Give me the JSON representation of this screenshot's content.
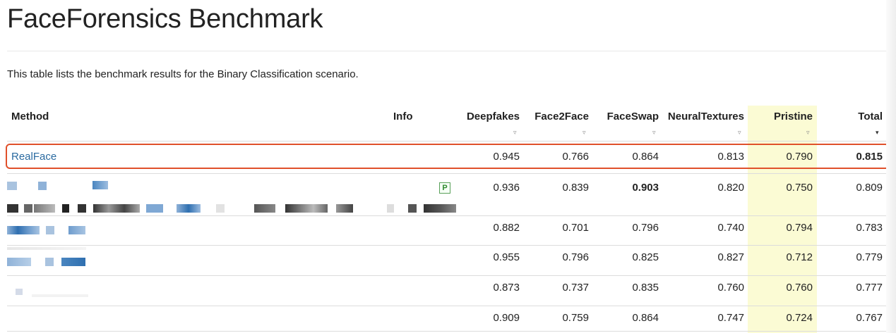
{
  "page": {
    "title": "FaceForensics Benchmark",
    "description": "This table lists the benchmark results for the Binary Classification scenario."
  },
  "table": {
    "columns": {
      "method": "Method",
      "info": "Info",
      "deepfakes": "Deepfakes",
      "face2face": "Face2Face",
      "faceswap": "FaceSwap",
      "neuraltextures": "NeuralTextures",
      "pristine": "Pristine",
      "total": "Total"
    },
    "sort_icons": {
      "inactive": "▿",
      "active": "▾"
    },
    "rows": [
      {
        "method": "RealFace",
        "deepfakes": "0.945",
        "face2face": "0.766",
        "faceswap": "0.864",
        "neuraltextures": "0.813",
        "pristine": "0.790",
        "total": "0.815"
      },
      {
        "method": "",
        "info_badge": "P",
        "deepfakes": "0.936",
        "face2face": "0.839",
        "faceswap": "0.903",
        "neuraltextures": "0.820",
        "pristine": "0.750",
        "total": "0.809"
      },
      {
        "method": "",
        "deepfakes": "0.882",
        "face2face": "0.701",
        "faceswap": "0.796",
        "neuraltextures": "0.740",
        "pristine": "0.794",
        "total": "0.783"
      },
      {
        "method": "",
        "deepfakes": "0.955",
        "face2face": "0.796",
        "faceswap": "0.825",
        "neuraltextures": "0.827",
        "pristine": "0.712",
        "total": "0.779"
      },
      {
        "method": "",
        "deepfakes": "0.873",
        "face2face": "0.737",
        "faceswap": "0.835",
        "neuraltextures": "0.760",
        "pristine": "0.760",
        "total": "0.777"
      },
      {
        "method": "",
        "deepfakes": "0.909",
        "face2face": "0.759",
        "faceswap": "0.864",
        "neuraltextures": "0.747",
        "pristine": "0.724",
        "total": "0.767"
      }
    ]
  },
  "colors": {
    "link": "#2a6aa0",
    "highlight_border": "#e0502a",
    "pristine_column": "#fbfbd4",
    "info_badge": "#2e8a2e"
  }
}
